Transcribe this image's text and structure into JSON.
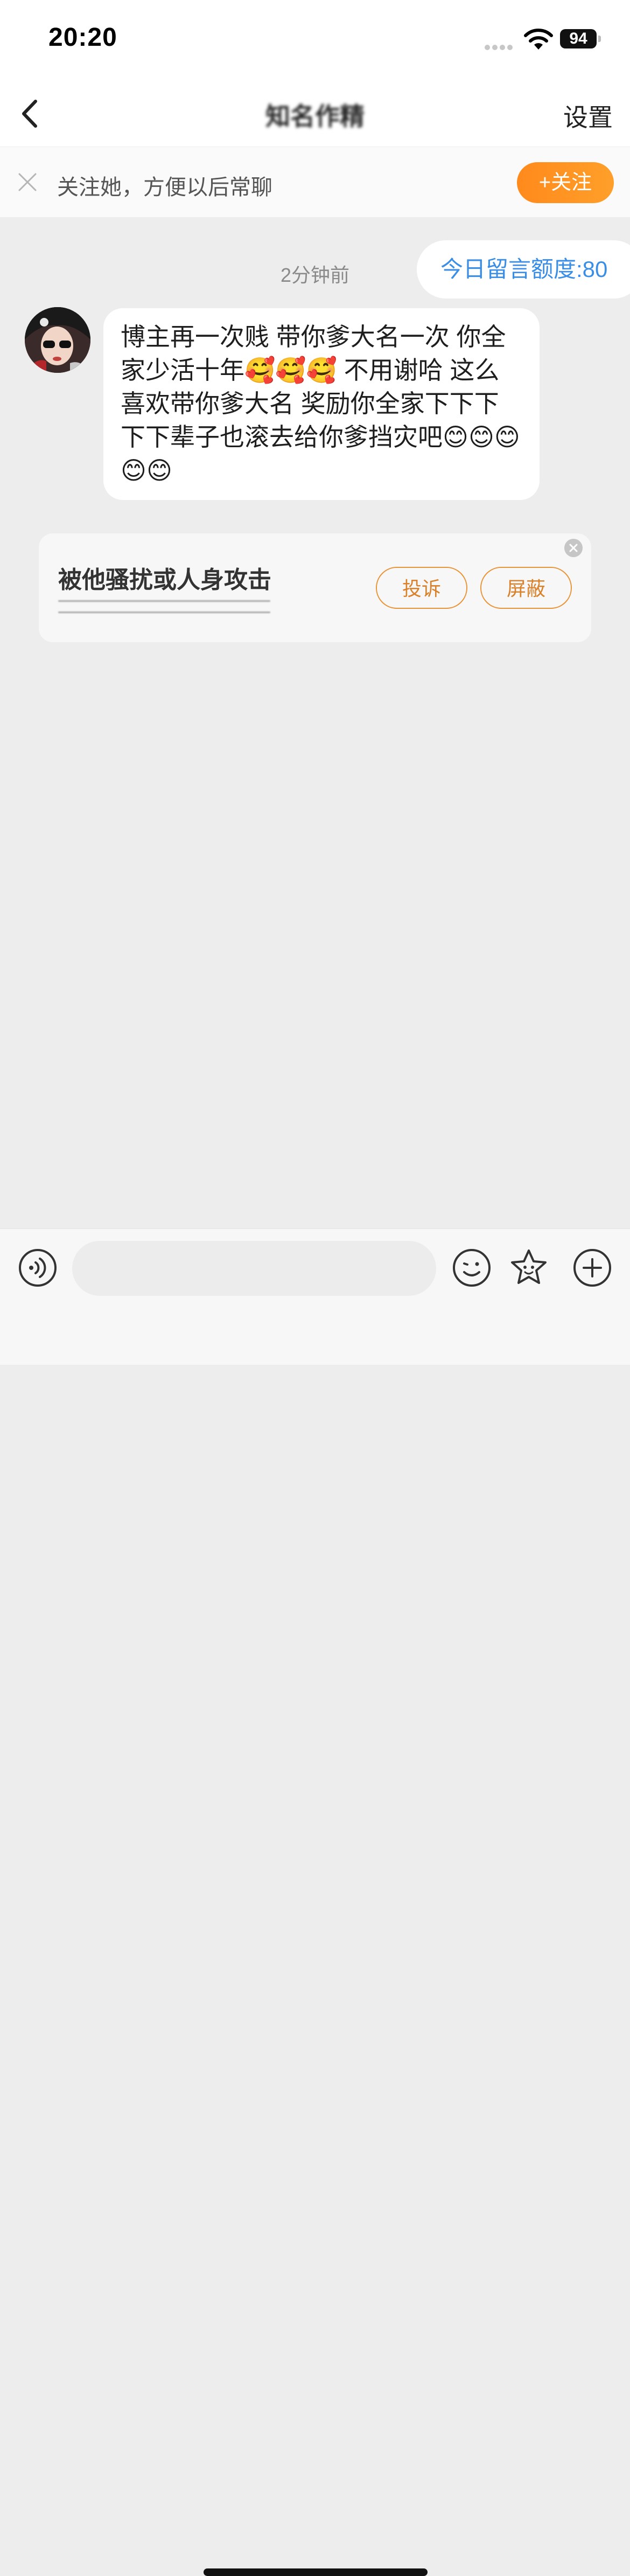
{
  "status_bar": {
    "time": "20:20",
    "battery": "94"
  },
  "nav": {
    "title": "知名作精",
    "settings_label": "设置"
  },
  "follow_bar": {
    "text": "关注她，方便以后常聊",
    "button_label": "+关注"
  },
  "chat": {
    "quota": "今日留言额度:80",
    "timestamp": "2分钟前",
    "message": "博主再一次贱 带你爹大名一次 你全家少活十年🥰🥰🥰 不用谢哈 这么喜欢带你爹大名 奖励你全家下下下下下辈子也滚去给你爹挡灾吧😊😊😊😊😊"
  },
  "report_card": {
    "title": "被他骚扰或人身攻击",
    "complain_label": "投诉",
    "block_label": "屏蔽"
  },
  "colors": {
    "accent_orange": "#ff8a1c",
    "quota_blue": "#3a8ee6",
    "background": "#ededed"
  }
}
